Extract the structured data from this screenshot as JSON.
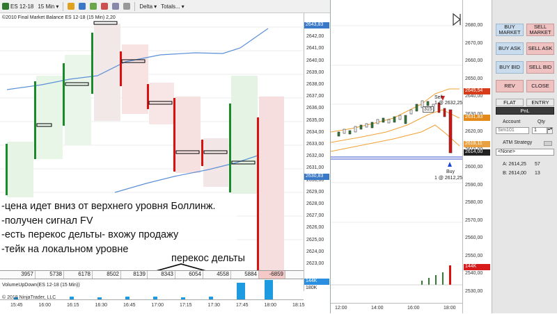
{
  "toolbar": {
    "instrument": "ES 12-18",
    "interval": "15 Min",
    "delta": "Delta",
    "totals": "Totals..."
  },
  "left_chart": {
    "title_line": "©2010 Final Market Balance ES 12-18 (15 Min) 2,20",
    "price_ticks": [
      "2643,00",
      "2642,00",
      "2641,00",
      "2640,00",
      "2639,00",
      "2638,00",
      "2637,00",
      "2636,00",
      "2635,00",
      "2634,00",
      "2633,00",
      "2632,00",
      "2631,00",
      "2630,00",
      "2629,00",
      "2628,00",
      "2627,00",
      "2626,00",
      "2625,00",
      "2624,00",
      "2623,00"
    ],
    "price_flag_top": "2643,83",
    "price_flag_mid": "2630,83",
    "price_flag_vol": "144K",
    "vol_scale": "180K",
    "time_ticks": [
      "15:45",
      "16:00",
      "16:15",
      "16:30",
      "16:45",
      "17:00",
      "17:15",
      "17:30",
      "17:45",
      "18:00",
      "18:15"
    ],
    "delta_values": [
      "3957",
      "5738",
      "6178",
      "8502",
      "8139",
      "8343",
      "6054",
      "4558",
      "5884",
      "-6859"
    ],
    "volume_title": "VolumeUpDown(ES 12-18 (15 Min))",
    "copyright": "© 2018 NinjaTrader, LLC",
    "annotation_lines": [
      "-цена идет вниз от верхнего уровня Боллинж.",
      "-получен сигнал FV",
      "-есть перекос дельты- вхожу продажу",
      "-тейк на локальном уровне"
    ],
    "annotation_delta": "перекос дельты"
  },
  "right_chart": {
    "price_ticks": [
      "2680,00",
      "2670,00",
      "2660,00",
      "2650,00",
      "2640,00",
      "2630,00",
      "2620,00",
      "2610,00",
      "2600,00",
      "2590,00",
      "2580,00",
      "2570,00",
      "2560,00",
      "2550,00",
      "2540,00",
      "2530,00"
    ],
    "flag_top": "2645,54",
    "flag_mid": "2631,83",
    "flag_low1": "2618,11",
    "flag_low2": "2614,00",
    "flag_vol": "144K",
    "sell_label": "Sell",
    "sell_price": "1 @ 2632,25",
    "sell_qty": "315",
    "buy_label": "Buy",
    "buy_price": "1 @ 2612,25",
    "time_ticks": [
      "12:00",
      "14:00",
      "16:00",
      "18:00"
    ]
  },
  "panel": {
    "buy_market": "BUY MARKET",
    "sell_market": "SELL MARKET",
    "buy_ask": "BUY ASK",
    "sell_ask": "SELL ASK",
    "buy_bid": "BUY BID",
    "sell_bid": "SELL BID",
    "rev": "REV",
    "close": "CLOSE",
    "flat": "FLAT",
    "entry": "ENTRY",
    "pnl": "PnL",
    "account_label": "Account",
    "qty_label": "Qty",
    "account_value": "Sim101",
    "qty_value": "1",
    "atm_label": "ATM Strategy",
    "atm_value": "<None>",
    "ask_label": "A: 2614,25",
    "ask_size": "57",
    "bid_label": "B: 2614,00",
    "bid_size": "13"
  },
  "colors": {
    "bull": "#1a8a2a",
    "bear": "#dd1010",
    "band": "#5b8fd8",
    "delta_pos": "#ccefcc",
    "delta_neg": "#f6c9c9"
  }
}
